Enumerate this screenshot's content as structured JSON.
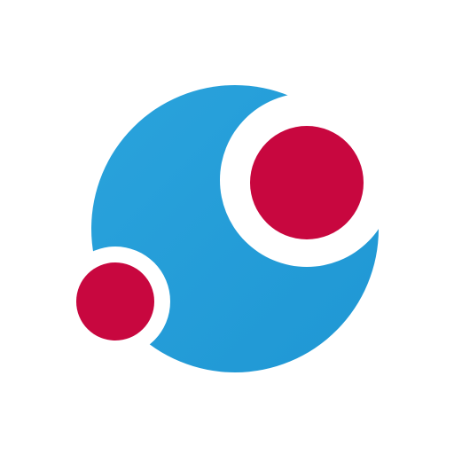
{
  "logo": {
    "icon": "bubbles-logo-icon",
    "colors": {
      "background": "#ffffff",
      "blue": "#279fd9",
      "red": "#c8073f",
      "ring": "#ffffff"
    }
  }
}
